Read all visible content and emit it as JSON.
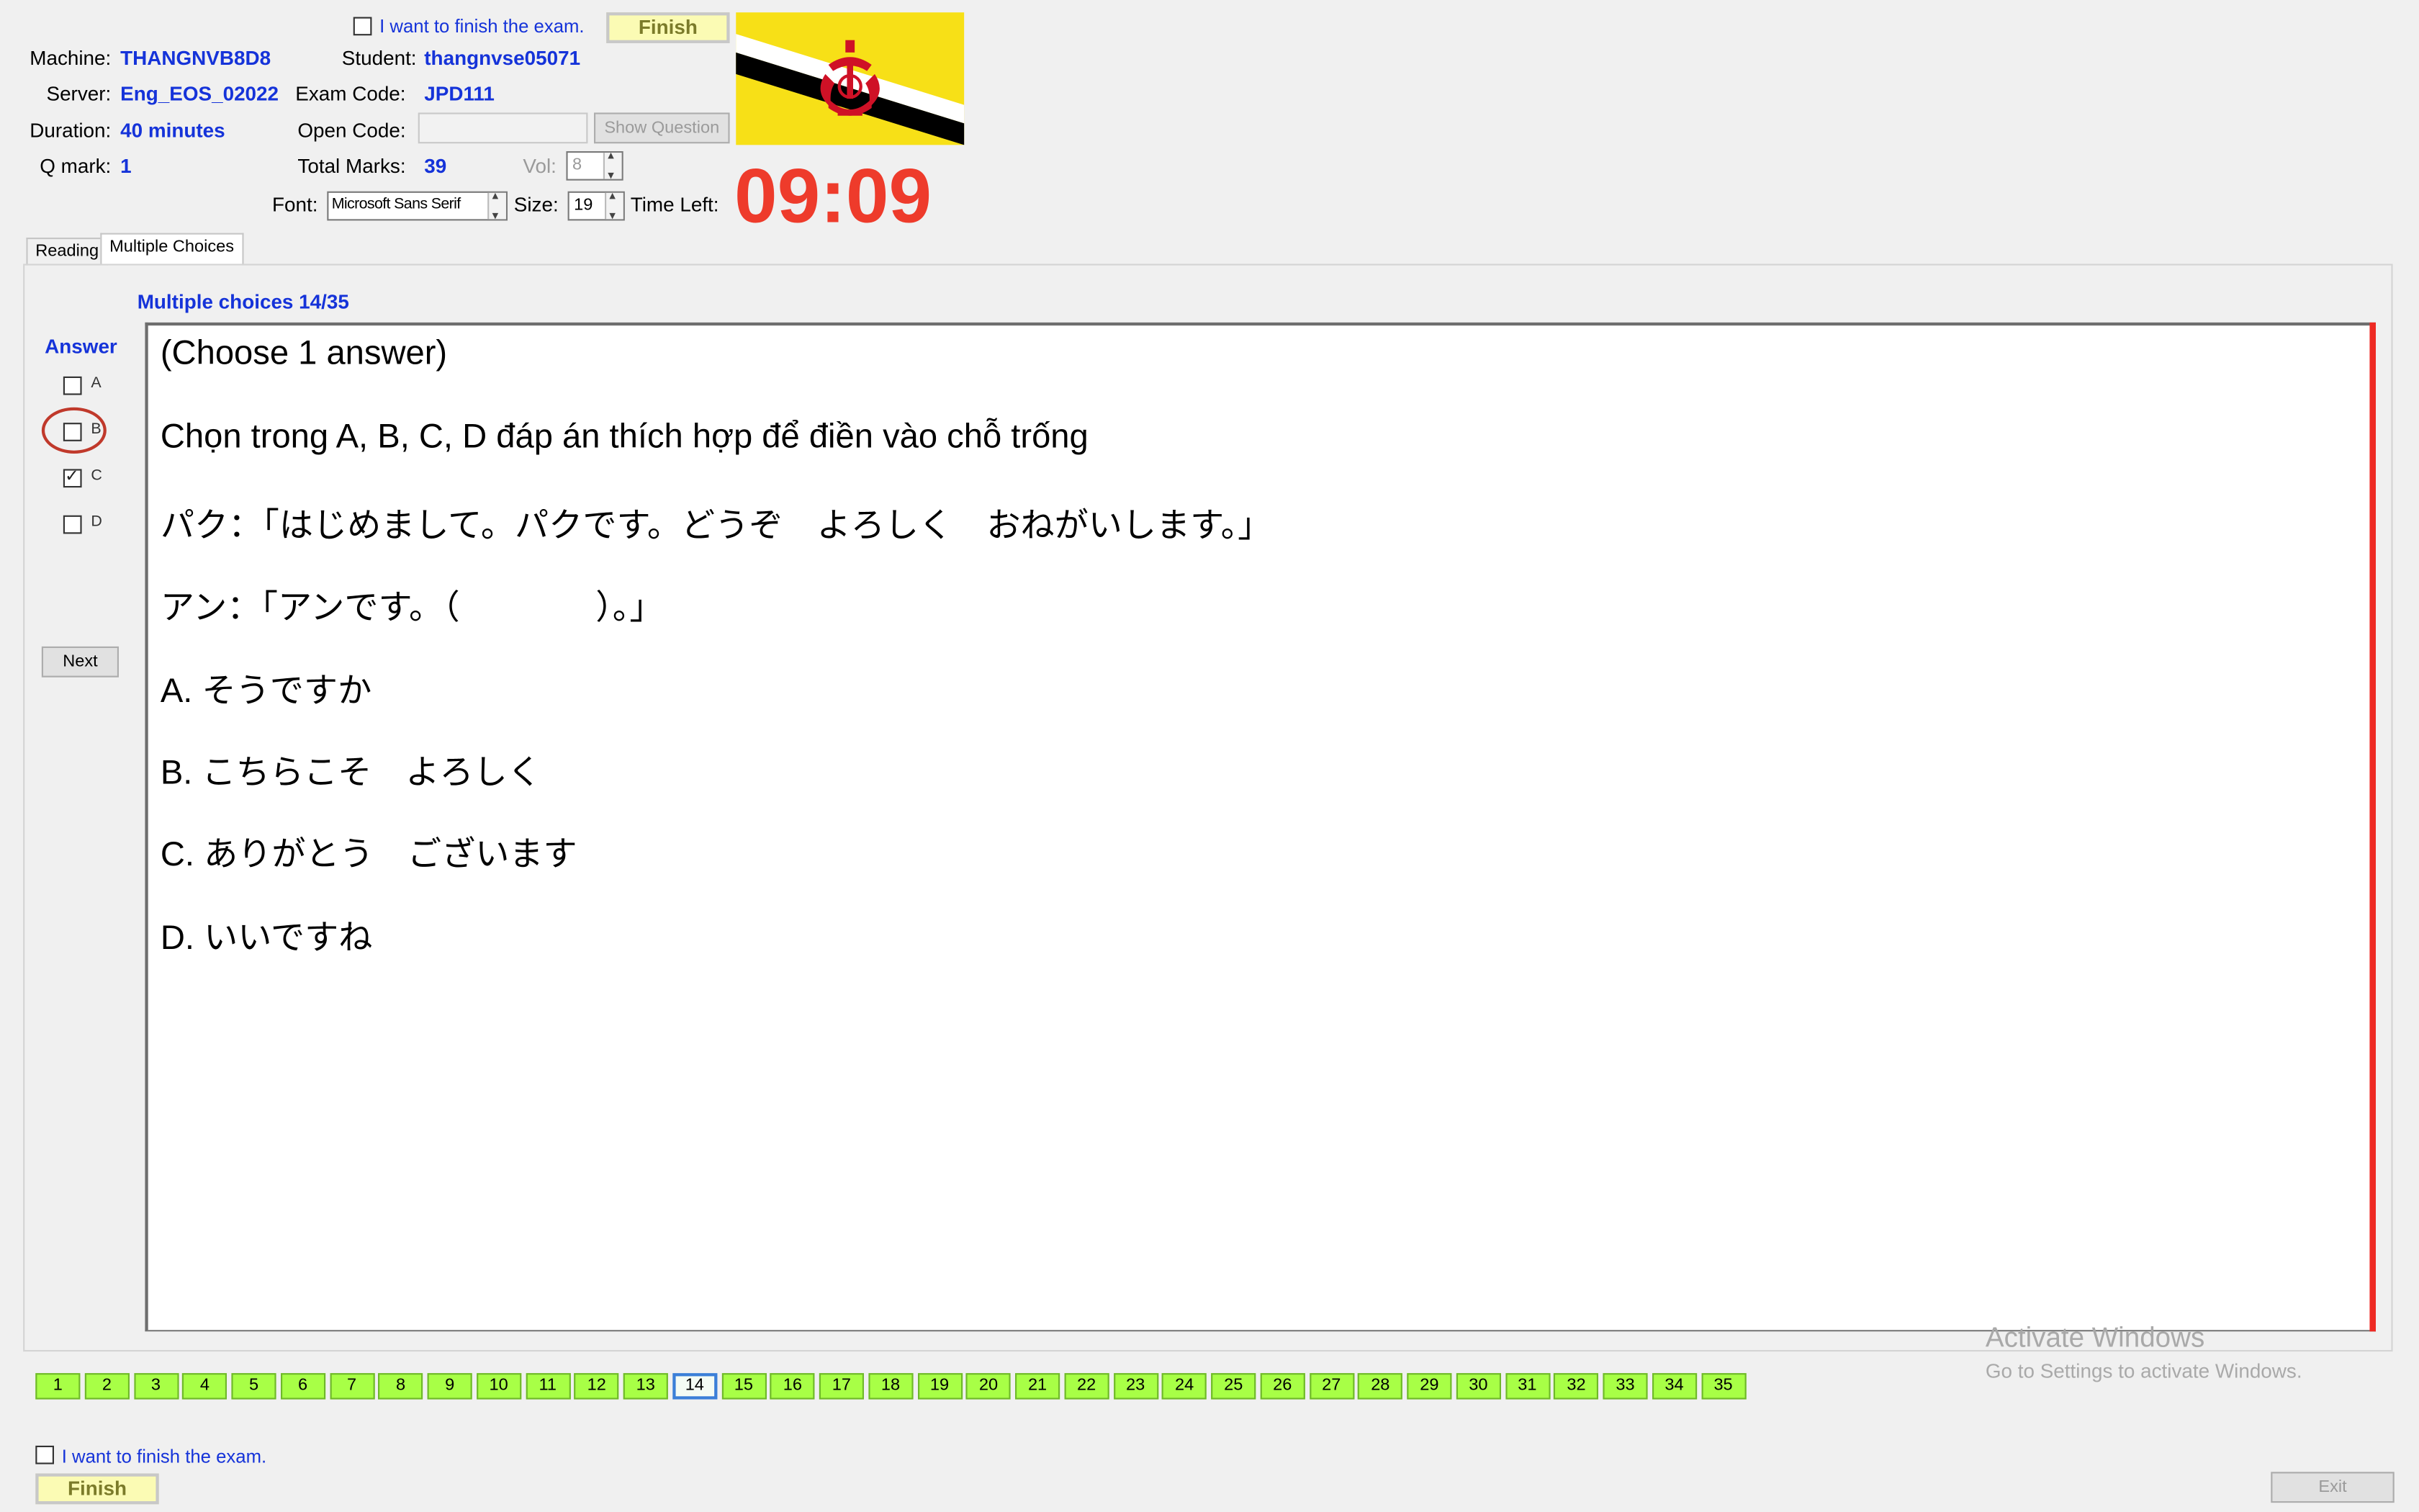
{
  "header": {
    "finish_top_check_label": "I want to finish the exam.",
    "finish_top_button": "Finish",
    "machine_label": "Machine:",
    "machine_value": "THANGNVB8D8",
    "student_label": "Student:",
    "student_value": "thangnvse05071",
    "server_label": "Server:",
    "server_value": "Eng_EOS_02022",
    "exam_code_label": "Exam Code:",
    "exam_code_value": "JPD111",
    "duration_label": "Duration:",
    "duration_value": "40 minutes",
    "open_code_label": "Open Code:",
    "show_question_button": "Show Question",
    "qmark_label": "Q mark:",
    "qmark_value": "1",
    "total_marks_label": "Total Marks:",
    "total_marks_value": "39",
    "vol_label": "Vol:",
    "vol_value": "8",
    "font_label": "Font:",
    "font_value": "Microsoft Sans Serif",
    "size_label": "Size:",
    "size_value": "19",
    "time_left_label": "Time Left:",
    "time_left_value": "09:09"
  },
  "tabs": [
    {
      "label": "Reading"
    },
    {
      "label": "Multiple Choices"
    }
  ],
  "question": {
    "heading": "Multiple choices 14/35",
    "answer_label": "Answer",
    "options": [
      {
        "label": "A",
        "checked": false
      },
      {
        "label": "B",
        "checked": false
      },
      {
        "label": "C",
        "checked": true
      },
      {
        "label": "D",
        "checked": false
      }
    ],
    "next_button": "Next",
    "lines": [
      "(Choose 1 answer)",
      "Chọn trong A, B, C, D đáp án thích hợp để điền vào chỗ trống",
      "パク：「はじめまして。パクです。どうぞ　よろしく　おねがいします。」",
      "アン：「アンです。（　　　　）。」",
      "A.  そうですか",
      "B.  こちらこそ　よろしく",
      "C.  ありがとう　ございます",
      "D.  いいですね"
    ]
  },
  "question_numbers": [
    "1",
    "2",
    "3",
    "4",
    "5",
    "6",
    "7",
    "8",
    "9",
    "10",
    "11",
    "12",
    "13",
    "14",
    "15",
    "16",
    "17",
    "18",
    "19",
    "20",
    "21",
    "22",
    "23",
    "24",
    "25",
    "26",
    "27",
    "28",
    "29",
    "30",
    "31",
    "32",
    "33",
    "34",
    "35"
  ],
  "current_question": "14",
  "watermark": {
    "title": "Activate Windows",
    "subtitle": "Go to Settings to activate Windows."
  },
  "footer": {
    "finish_check_label": "I want to finish the exam.",
    "finish_button": "Finish",
    "exit_button": "Exit"
  },
  "colors": {
    "value_blue": "#1533d9",
    "timer_red": "#ee3b2b",
    "question_done_green": "#a8ff46",
    "finish_yellow": "#fbfbb4"
  }
}
